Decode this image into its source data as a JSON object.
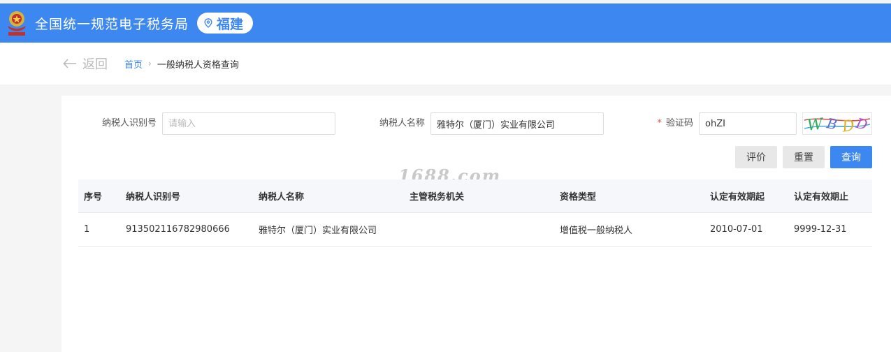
{
  "header": {
    "site_title": "全国统一规范电子税务局",
    "region": "福建"
  },
  "nav": {
    "back_label": "返回",
    "breadcrumb_home": "首页",
    "breadcrumb_separator": "›",
    "breadcrumb_current": "一般纳税人资格查询"
  },
  "form": {
    "taxpayer_id": {
      "label": "纳税人识别号",
      "value": "",
      "placeholder": "请输入"
    },
    "taxpayer_name": {
      "label": "纳税人名称",
      "value": "雅特尔（厦门）实业有限公司",
      "placeholder": ""
    },
    "captcha": {
      "required_mark": "*",
      "label": "验证码",
      "value": "ohZI",
      "image_text": "WBDD"
    }
  },
  "buttons": {
    "rate": "评价",
    "reset": "重置",
    "query": "查询"
  },
  "watermark": "1688.com",
  "table": {
    "columns": [
      "序号",
      "纳税人识别号",
      "纳税人名称",
      "主管税务机关",
      "资格类型",
      "认定有效期起",
      "认定有效期止"
    ],
    "rows": [
      [
        "1",
        "913502116782980666",
        "雅特尔（厦门）实业有限公司",
        "",
        "增值税一般纳税人",
        "2010-07-01",
        "9999-12-31"
      ]
    ]
  },
  "colors": {
    "brand_blue": "#3d87f0",
    "required_red": "#f04b4b"
  },
  "icons": {
    "emblem": "tax-emblem-icon",
    "location": "location-pin-icon",
    "back": "arrow-left-icon"
  }
}
